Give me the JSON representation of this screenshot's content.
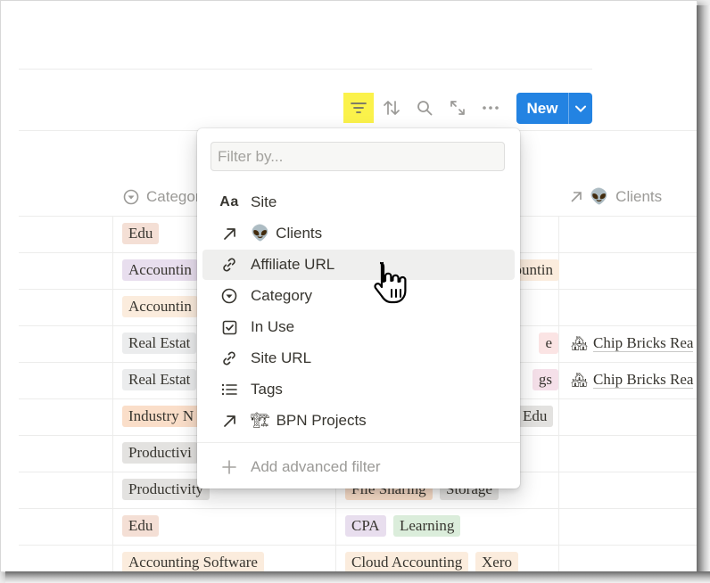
{
  "toolbar": {
    "icons": [
      "filter-icon",
      "sort-icon",
      "search-icon",
      "expand-icon",
      "more-icon"
    ],
    "new_label": "New",
    "highlight_color": "#fbf24b",
    "accent_color": "#2383e2"
  },
  "columns": {
    "category": "Categor",
    "clients": "Clients"
  },
  "rows": [
    {
      "category": {
        "text": "Edu",
        "color": "#f4dfd5"
      }
    },
    {
      "category": {
        "text": "Accountin",
        "color": "#e8deee"
      },
      "mid": [
        {
          "text": "ountin",
          "color": "#fbecdd"
        }
      ]
    },
    {
      "category": {
        "text": "Accountin",
        "color": "#fbecdd"
      }
    },
    {
      "category": {
        "text": "Real Estat",
        "color": "#ebeced"
      },
      "mid": [
        {
          "text": "e",
          "color": "#fbe4e4"
        }
      ],
      "client": "Chip Bricks Rea"
    },
    {
      "category": {
        "text": "Real Estat",
        "color": "#ebeced"
      },
      "mid": [
        {
          "text": "gs",
          "color": "#f5e0e9"
        }
      ],
      "client": "Chip Bricks Rea"
    },
    {
      "category": {
        "text": "Industry N",
        "color": "#fadec9"
      },
      "mid": [
        {
          "text": "Edu",
          "color": "#e3e2e0"
        }
      ]
    },
    {
      "category": {
        "text": "Productivi",
        "color": "#e3e2e0"
      }
    },
    {
      "category": {
        "text": "Productivity",
        "color": "#e3e2e0"
      },
      "mid": [
        {
          "text": "File Sharing",
          "color": "#fadec9"
        },
        {
          "text": "Storage",
          "color": "#e3e2e0"
        }
      ]
    },
    {
      "category": {
        "text": "Edu",
        "color": "#f4dfd5"
      },
      "mid": [
        {
          "text": "CPA",
          "color": "#e8deee"
        },
        {
          "text": "Learning",
          "color": "#dbeddb"
        }
      ]
    },
    {
      "category": {
        "text": "Accounting Software",
        "color": "#fbecdd"
      },
      "mid": [
        {
          "text": "Cloud Accounting",
          "color": "#fbecdd"
        },
        {
          "text": "Xero",
          "color": "#fbecdd"
        }
      ]
    }
  ],
  "filter_menu": {
    "placeholder": "Filter by...",
    "items": [
      {
        "label": "Site",
        "icon": "text-property-icon",
        "icon_text": "Aa"
      },
      {
        "label": "Clients",
        "icon": "relation-arrow-icon",
        "emoji": "👽"
      },
      {
        "label": "Affiliate URL",
        "icon": "link-icon"
      },
      {
        "label": "Category",
        "icon": "select-icon"
      },
      {
        "label": "In Use",
        "icon": "checkbox-icon"
      },
      {
        "label": "Site URL",
        "icon": "link-icon"
      },
      {
        "label": "Tags",
        "icon": "list-icon"
      },
      {
        "label": "BPN Projects",
        "icon": "relation-arrow-icon",
        "emoji": "🏗"
      }
    ],
    "advanced_label": "Add advanced filter"
  }
}
